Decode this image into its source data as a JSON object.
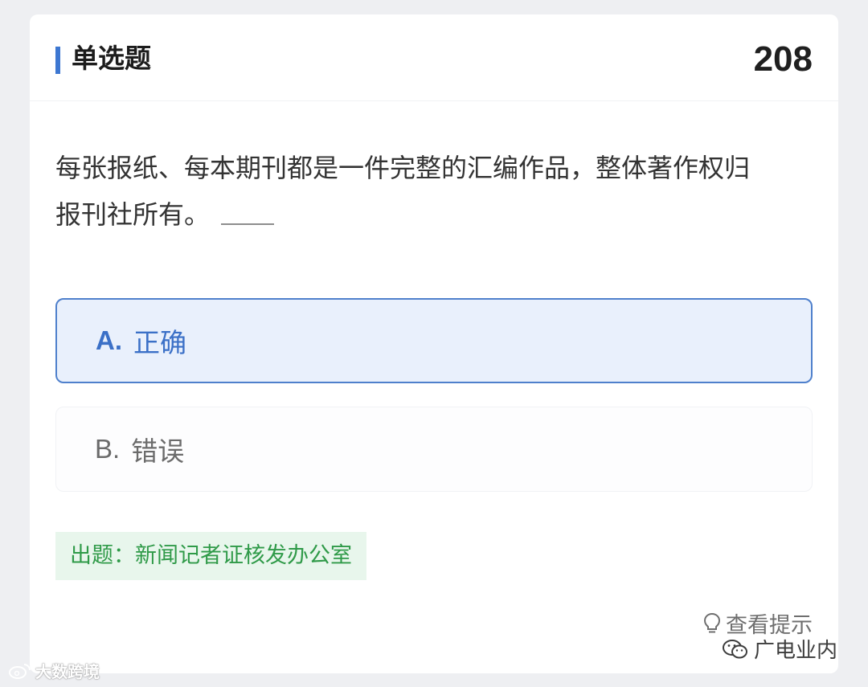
{
  "header": {
    "title": "单选题",
    "question_number": "208"
  },
  "question": {
    "text_line1": "每张报纸、每本期刊都是一件完整的汇编作品，整体著作权归",
    "text_line2": "报刊社所有。"
  },
  "options": [
    {
      "letter": "A.",
      "label": "正确",
      "state": "selected"
    },
    {
      "letter": "B.",
      "label": "错误",
      "state": "unselected"
    }
  ],
  "source_tag": "出题：新闻记者证核发办公室",
  "hint": {
    "label": "查看提示",
    "icon": "lightbulb-icon"
  },
  "watermarks": {
    "right": "广电业内",
    "left": "大数跨境"
  },
  "colors": {
    "accent": "#3d77d1",
    "selected_bg": "#e9f0fc",
    "source_bg": "#e8f6ec",
    "source_text": "#2f9a48"
  }
}
